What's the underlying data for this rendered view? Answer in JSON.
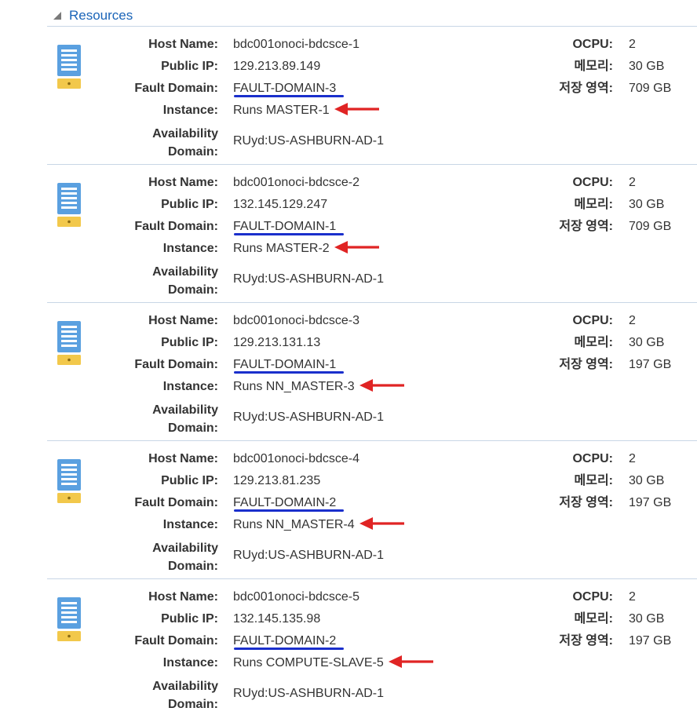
{
  "section": {
    "title": "Resources",
    "toggle_icon": "collapse-triangle-icon"
  },
  "labels": {
    "host_name": "Host Name:",
    "public_ip": "Public IP:",
    "fault_domain": "Fault Domain:",
    "instance": "Instance:",
    "availability_line1": "Availability",
    "availability_line2": "Domain:",
    "ocpu": "OCPU:",
    "memory": "메모리:",
    "storage": "저장 영역:"
  },
  "colors": {
    "link": "#1a64b8",
    "underline": "#1a2fcc",
    "arrow": "#e02424",
    "server_icon": "#5aa0e0",
    "server_base": "#f2c84b"
  },
  "hosts": [
    {
      "host_name": "bdc001onoci-bdcsce-1",
      "public_ip": "129.213.89.149",
      "fault_domain": "FAULT-DOMAIN-3",
      "instance": "Runs MASTER-1",
      "availability_domain": "RUyd:US-ASHBURN-AD-1",
      "ocpu": "2",
      "memory": "30 GB",
      "storage": "709 GB"
    },
    {
      "host_name": "bdc001onoci-bdcsce-2",
      "public_ip": "132.145.129.247",
      "fault_domain": "FAULT-DOMAIN-1",
      "instance": "Runs MASTER-2",
      "availability_domain": "RUyd:US-ASHBURN-AD-1",
      "ocpu": "2",
      "memory": "30 GB",
      "storage": "709 GB"
    },
    {
      "host_name": "bdc001onoci-bdcsce-3",
      "public_ip": "129.213.131.13",
      "fault_domain": "FAULT-DOMAIN-1",
      "instance": "Runs NN_MASTER-3",
      "availability_domain": "RUyd:US-ASHBURN-AD-1",
      "ocpu": "2",
      "memory": "30 GB",
      "storage": "197 GB"
    },
    {
      "host_name": "bdc001onoci-bdcsce-4",
      "public_ip": "129.213.81.235",
      "fault_domain": "FAULT-DOMAIN-2",
      "instance": "Runs NN_MASTER-4",
      "availability_domain": "RUyd:US-ASHBURN-AD-1",
      "ocpu": "2",
      "memory": "30 GB",
      "storage": "197 GB"
    },
    {
      "host_name": "bdc001onoci-bdcsce-5",
      "public_ip": "132.145.135.98",
      "fault_domain": "FAULT-DOMAIN-2",
      "instance": "Runs COMPUTE-SLAVE-5",
      "availability_domain": "RUyd:US-ASHBURN-AD-1",
      "ocpu": "2",
      "memory": "30 GB",
      "storage": "197 GB"
    }
  ]
}
